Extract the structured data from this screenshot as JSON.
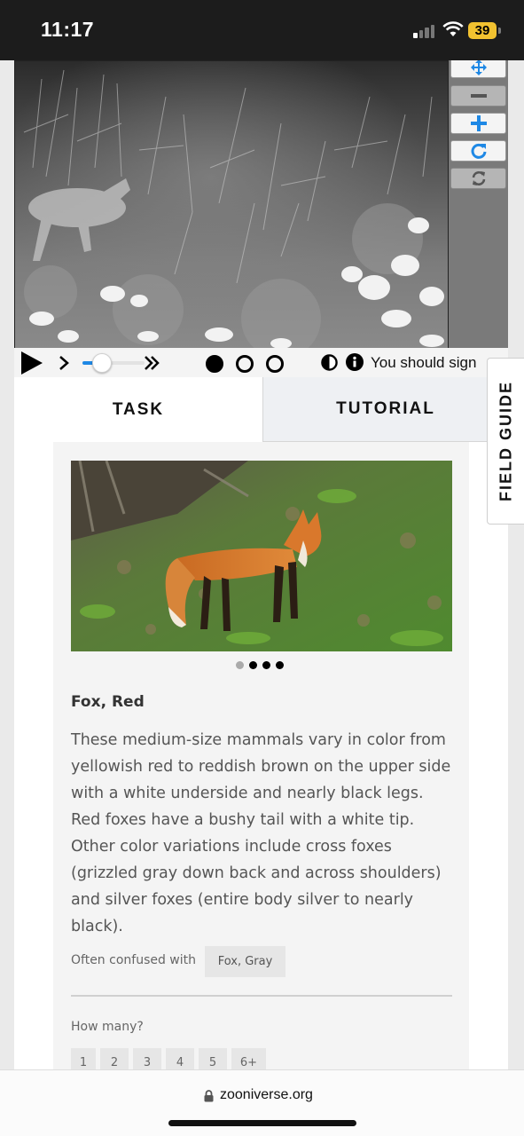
{
  "status_bar": {
    "time": "11:17",
    "battery": "39"
  },
  "viewer": {
    "tools": [
      {
        "name": "move",
        "icon": "move-icon"
      },
      {
        "name": "zoom-out",
        "icon": "minus-icon"
      },
      {
        "name": "zoom-in",
        "icon": "plus-icon"
      },
      {
        "name": "rotate",
        "icon": "rotate-icon"
      },
      {
        "name": "reset",
        "icon": "reset-icon"
      }
    ],
    "playback_speed_level": 0.25,
    "sign_in_text": "You should sign"
  },
  "tabs": {
    "task": "TASK",
    "tutorial": "TUTORIAL"
  },
  "field_guide_tab": "FIELD GUIDE",
  "field_guide": {
    "carousel_active_index": 1,
    "carousel_count": 4,
    "species_title": "Fox, Red",
    "description": "These medium-size mammals vary in color from yellowish red to reddish brown on the upper side with a white underside and nearly black legs. Red foxes have a bushy tail with a white tip. Other color variations include cross foxes (grizzled gray down back and across shoulders) and silver foxes (entire body silver to nearly black).",
    "confused_label": "Often confused with",
    "confused_with": "Fox, Gray",
    "how_many_label": "How many?",
    "counts": [
      "1",
      "2",
      "3",
      "4",
      "5",
      "6+"
    ]
  },
  "browser": {
    "url": "zooniverse.org"
  },
  "colors": {
    "accent_blue": "#1e88e5",
    "status_bar": "#1c1c1c",
    "battery": "#f2c230"
  }
}
